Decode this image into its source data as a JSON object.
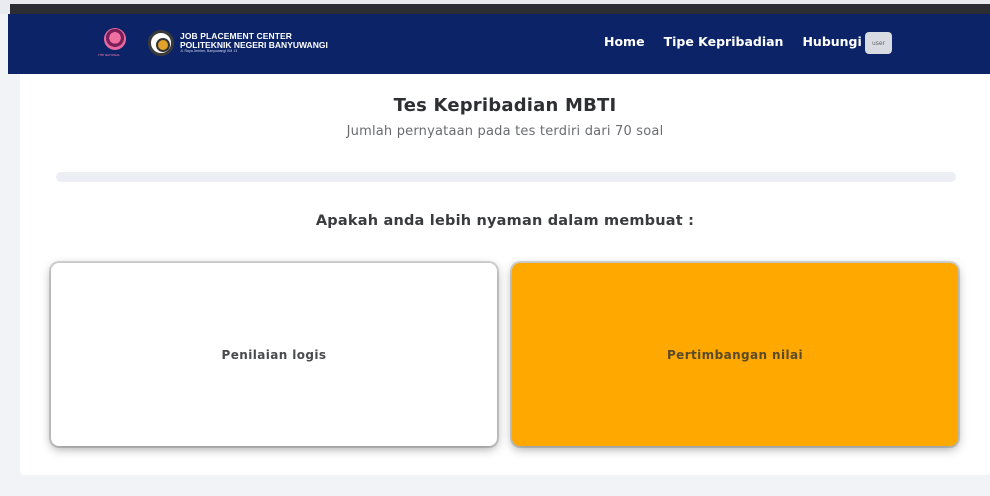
{
  "colors": {
    "navbar": "#0c2467",
    "accent": "#ffa800",
    "background": "#f1f3f6"
  },
  "brand": {
    "logo_caption": "THE NATIONAL",
    "line1": "JOB PLACEMENT CENTER",
    "line2": "POLITEKNIK NEGERI BANYUWANGI",
    "line3": "Jl. Raya Jember, Banyuwangi KM 13"
  },
  "nav": {
    "items": [
      {
        "label": "Home"
      },
      {
        "label": "Tipe Kepribadian"
      },
      {
        "label": "Hubungi"
      }
    ],
    "avatar_label": "user"
  },
  "test": {
    "title": "Tes Kepribadian MBTI",
    "subtitle": "Jumlah pernyataan pada tes terdiri dari 70 soal",
    "progress": 0,
    "question": "Apakah anda lebih nyaman dalam membuat :",
    "options": [
      {
        "label": "Penilaian logis",
        "selected": false
      },
      {
        "label": "Pertimbangan nilai",
        "selected": true
      }
    ]
  }
}
